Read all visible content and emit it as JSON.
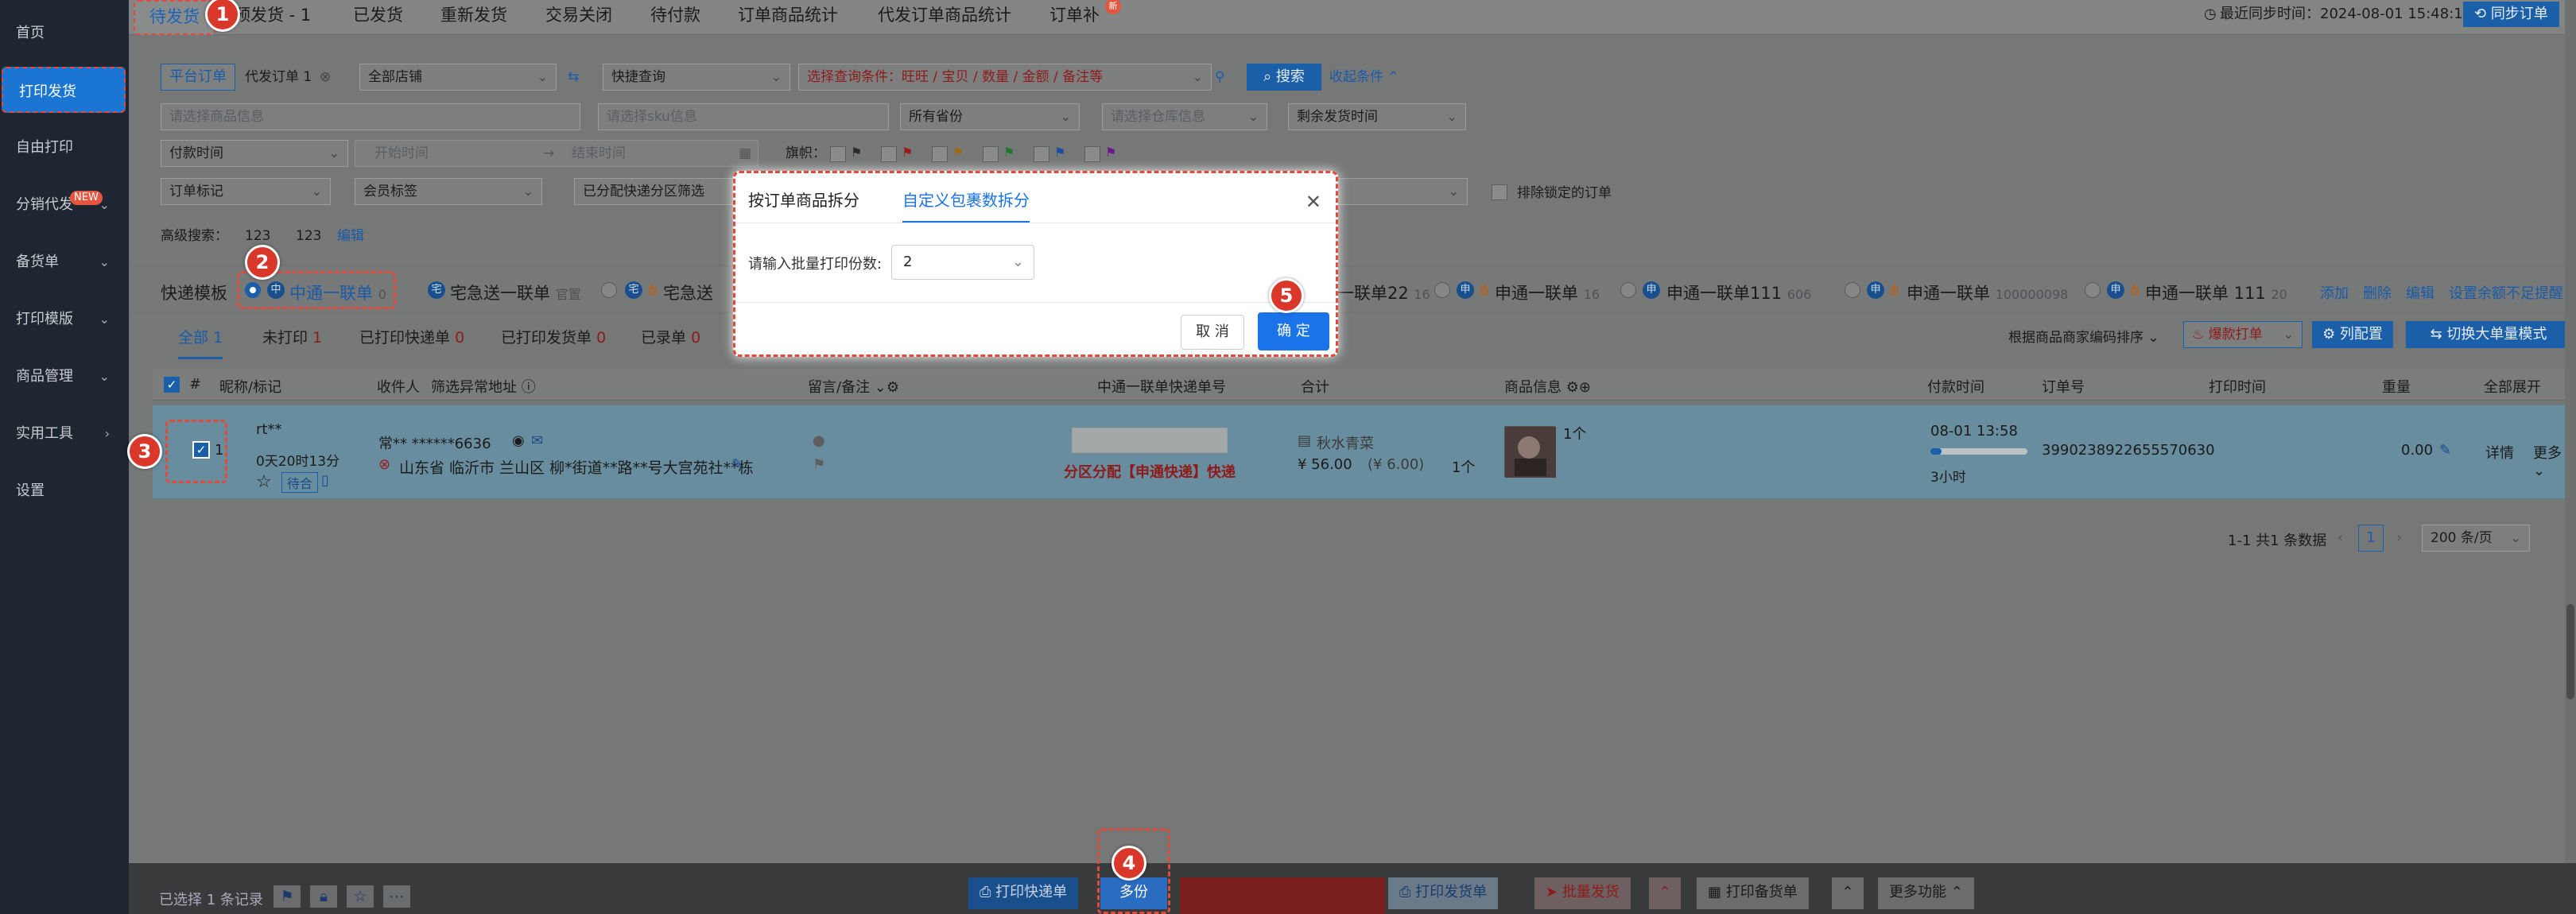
{
  "sidebar": {
    "items": [
      {
        "label": "首页"
      },
      {
        "label": "打印发货"
      },
      {
        "label": "自由打印"
      },
      {
        "label": "分销代发",
        "badge": "NEW"
      },
      {
        "label": "备货单"
      },
      {
        "label": "打印模版"
      },
      {
        "label": "商品管理"
      },
      {
        "label": "实用工具"
      },
      {
        "label": "设置"
      }
    ]
  },
  "tabs": [
    {
      "label": "待发货"
    },
    {
      "label": "预发货 - 1"
    },
    {
      "label": "已发货"
    },
    {
      "label": "重新发货"
    },
    {
      "label": "交易关闭"
    },
    {
      "label": "待付款"
    },
    {
      "label": "订单商品统计"
    },
    {
      "label": "代发订单商品统计"
    },
    {
      "label": "订单补",
      "badge": "新"
    }
  ],
  "sync": {
    "text": "最近同步时间：2024-08-01 15:48:14",
    "button": "同步订单"
  },
  "filters": {
    "platform_btn": "平台订单",
    "daifa": "代发订单 1",
    "shop": "全部店铺",
    "quick": "快捷查询",
    "condition": "选择查询条件：旺旺 / 宝贝 / 数量 / 金额 / 备注等",
    "search_btn": "搜索",
    "collapse": "收起条件",
    "goods_ph": "请选择商品信息",
    "sku_ph": "请选择sku信息",
    "province": "所有省份",
    "warehouse_ph": "请选择仓库信息",
    "remain": "剩余发货时间",
    "paytime": "付款时间",
    "start_ph": "开始时间",
    "end_ph": "结束时间",
    "flag_label": "旗帜：",
    "order_mark": "订单标记",
    "member_tag": "会员标签",
    "split_filter": "已分配快递分区筛选",
    "exclude_locked": "排除锁定的订单",
    "advanced_label": "高级搜索：",
    "adv1": "123",
    "adv2": "123",
    "adv_edit": "编辑"
  },
  "templates": {
    "label": "快递模板",
    "items": [
      {
        "name": "中通一联单",
        "count": "0"
      },
      {
        "name": "宅急送一联单",
        "count": "官置"
      },
      {
        "name": "宅急送",
        "count": ""
      },
      {
        "name": "一联单22",
        "count": "16"
      },
      {
        "name": "申通一联单",
        "count": "16"
      },
      {
        "name": "申通一联单111",
        "count": "606"
      },
      {
        "name": "申通一联单",
        "count": "100000098"
      },
      {
        "name": "申通一联单 111",
        "count": "20"
      }
    ],
    "actions": [
      "添加",
      "删除",
      "编辑",
      "设置余额不足提醒"
    ]
  },
  "status_tabs": [
    {
      "label": "全部",
      "count": "1"
    },
    {
      "label": "未打印",
      "count": "1"
    },
    {
      "label": "已打印快递单",
      "count": "0"
    },
    {
      "label": "已打印发货单",
      "count": "0"
    },
    {
      "label": "已录单",
      "count": "0"
    }
  ],
  "toolbar_right": {
    "sort": "根据商品商家编码排序",
    "hot_print": "爆款打单",
    "col_config": "列配置",
    "switch_mode": "切换大单量模式"
  },
  "table": {
    "headers": [
      "#",
      "昵称/标记",
      "收件人",
      "筛选异常地址",
      "留言/备注",
      "中通一联单快递单号",
      "合计",
      "商品信息",
      "付款时间",
      "订单号",
      "打印时间",
      "重量",
      "全部展开"
    ],
    "row": {
      "index": "1",
      "nick": "rt**",
      "time_left": "0天20时13分",
      "tag": "待合",
      "receiver": "常** ******6636",
      "address": "山东省 临沂市 兰山区 柳*街道**路**号大宫苑社**栋",
      "express_input": "",
      "split_note": "分区分配【申通快递】快递",
      "seller": "秋水青菜",
      "amount": "¥ 56.00",
      "amount_orig": "(¥ 6.00)",
      "qty": "1个",
      "goods_qty": "1个",
      "paytime": "08-01 13:58",
      "paytime_ago": "3小时",
      "order_no": "3990238922655570630",
      "weight": "0.00",
      "detail": "详情",
      "more": "更多"
    }
  },
  "pagination": {
    "summary": "1-1 共1 条数据",
    "page": "1",
    "page_size": "200 条/页"
  },
  "footer": {
    "selected": "已选择 1 条记录",
    "print_express": "打印快递单",
    "multi": "多份",
    "print_delivery": "打印发货单",
    "batch_ship": "批量发货",
    "print_stock": "打印备货单",
    "more": "更多功能"
  },
  "dialog": {
    "tab1": "按订单商品拆分",
    "tab2": "自定义包裹数拆分",
    "field_label": "请输入批量打印份数:",
    "field_value": "2",
    "cancel": "取 消",
    "confirm": "确 定"
  },
  "steps": [
    "1",
    "2",
    "3",
    "4",
    "5"
  ]
}
